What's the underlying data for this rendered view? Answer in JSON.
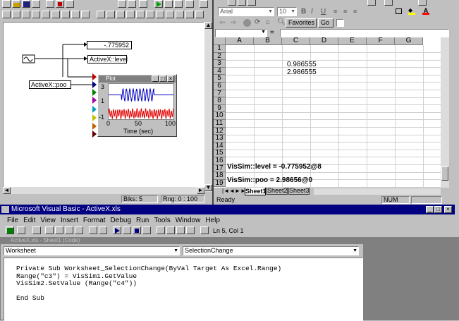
{
  "vissim": {
    "display_value": "-.775952",
    "level_block": "ActiveX::level",
    "poo_block": "ActiveX::poo",
    "plot": {
      "title": "Plot",
      "y_ticks": [
        "3",
        "1",
        "-1"
      ],
      "x_ticks": [
        "0",
        "50",
        "100"
      ],
      "xlabel": "Time (sec)"
    },
    "status": {
      "blks": "Blks: 5",
      "rng": "Rng: 0 : 100"
    }
  },
  "excel": {
    "font_name": "Arial",
    "font_size": "10",
    "favorites": "Favorites",
    "go": "Go",
    "columns": [
      "A",
      "B",
      "C",
      "D",
      "E",
      "F",
      "G"
    ],
    "rows": [
      "1",
      "2",
      "3",
      "4",
      "5",
      "6",
      "7",
      "8",
      "9",
      "10",
      "11",
      "12",
      "13",
      "14",
      "15",
      "16",
      "17",
      "18",
      "19"
    ],
    "c3": "0.986555",
    "c4": "2.986555",
    "a16": "VisSim::level = -0.775952@8",
    "a18": "VisSim::poo = 2.98656@0",
    "sheets": [
      "Sheet1",
      "Sheet2",
      "Sheet3"
    ],
    "status": "Ready",
    "num": "NUM"
  },
  "vb": {
    "title": "Microsoft Visual Basic - ActiveX.xls",
    "menu": [
      "File",
      "Edit",
      "View",
      "Insert",
      "Format",
      "Debug",
      "Run",
      "Tools",
      "Window",
      "Help"
    ],
    "position": "Ln 5, Col 1",
    "code_window_title": "ActiveX.xls - Sheet1 (Code)",
    "object_combo": "Worksheet",
    "proc_combo": "SelectionChange",
    "code_lines": [
      "Private Sub Worksheet_SelectionChange(ByVal Target As Excel.Range)",
      "Range(\"c3\") = VisSim1.GetValue",
      "VisSim2.SetValue (Range(\"c4\"))",
      "",
      "End Sub"
    ]
  }
}
